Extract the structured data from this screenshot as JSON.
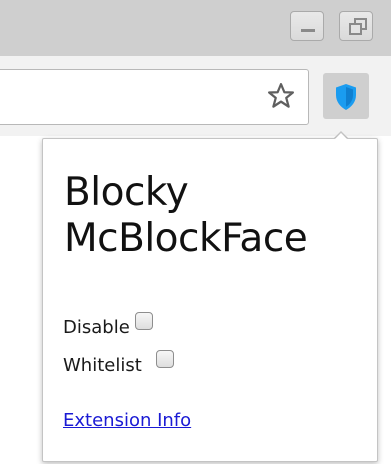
{
  "window": {
    "controls": [
      "minimize",
      "restore"
    ]
  },
  "toolbar": {
    "bookmark_icon": "star-outline-icon",
    "extension_icon": "shield-icon",
    "extension_icon_color": "#1a9cf0"
  },
  "popup": {
    "title": "Blocky McBlockFace",
    "options": [
      {
        "label": "Disable",
        "checked": false
      },
      {
        "label": "Whitelist",
        "checked": false
      }
    ],
    "link_label": "Extension Info",
    "link_color": "#1a1ad4"
  }
}
